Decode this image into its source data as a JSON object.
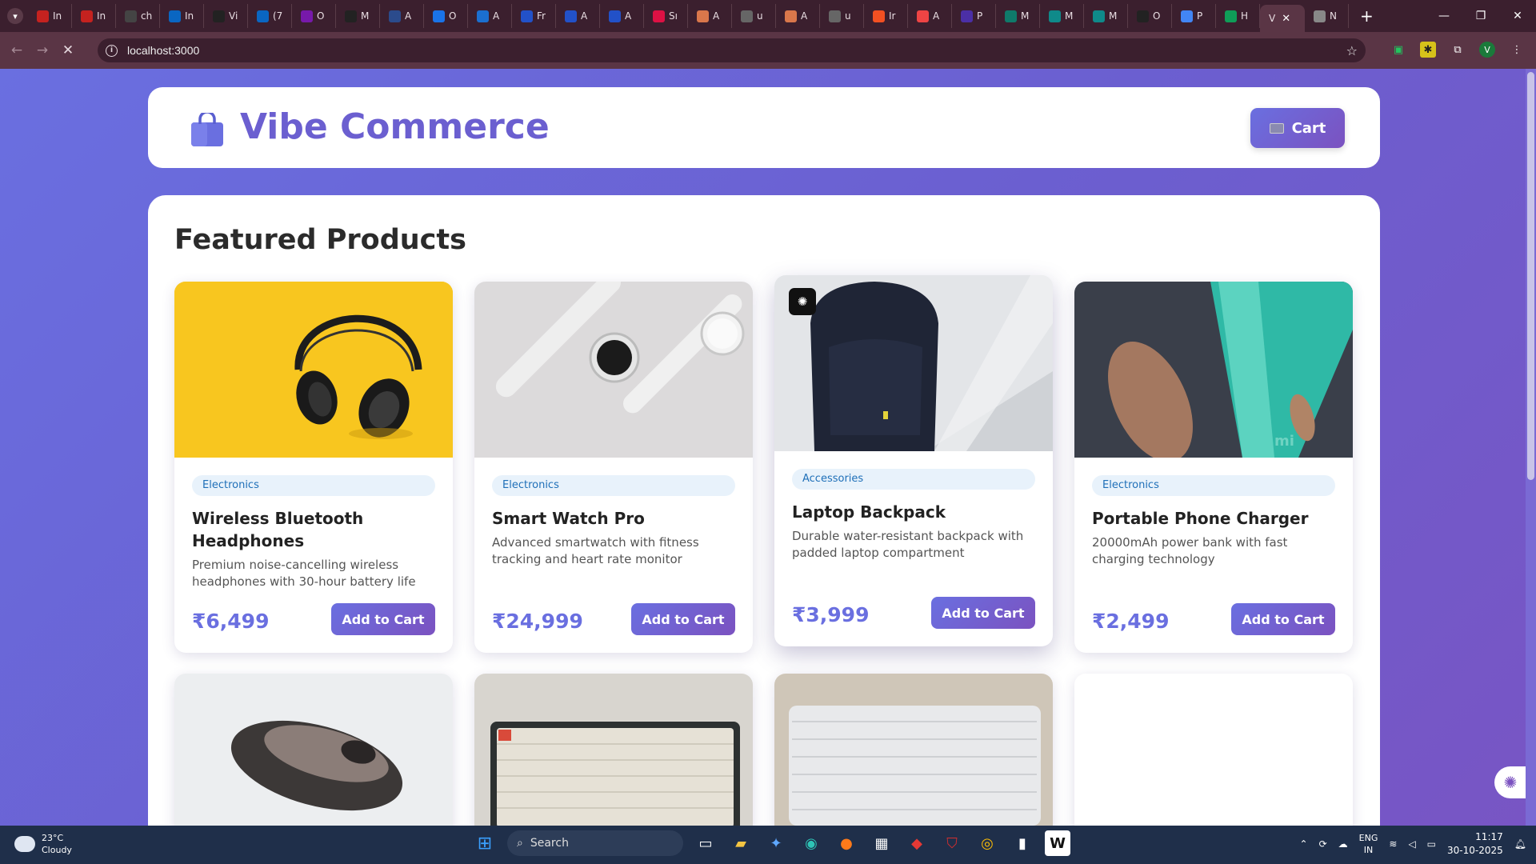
{
  "browser": {
    "tabs": [
      {
        "label": "In",
        "icon": "gmail-icon",
        "color": "#c5221f"
      },
      {
        "label": "In",
        "icon": "gmail-icon",
        "color": "#c5221f"
      },
      {
        "label": "ch",
        "icon": "openai-icon",
        "color": "#444"
      },
      {
        "label": "In",
        "icon": "linkedin-square-icon",
        "color": "#0a66c2"
      },
      {
        "label": "Vi",
        "icon": "github-icon",
        "color": "#222"
      },
      {
        "label": "(7",
        "icon": "linkedin-icon",
        "color": "#0a66c2"
      },
      {
        "label": "O",
        "icon": "onenote-icon",
        "color": "#7719aa"
      },
      {
        "label": "M",
        "icon": "medium-icon",
        "color": "#222"
      },
      {
        "label": "A",
        "icon": "crescent-icon",
        "color": "#2b4b8c"
      },
      {
        "label": "O",
        "icon": "target-icon",
        "color": "#1a73e8"
      },
      {
        "label": "A",
        "icon": "p-icon",
        "color": "#1b6fd0"
      },
      {
        "label": "Fr",
        "icon": "k-icon",
        "color": "#2251c8"
      },
      {
        "label": "A",
        "icon": "k-icon",
        "color": "#2251c8"
      },
      {
        "label": "A",
        "icon": "k-icon",
        "color": "#2251c8"
      },
      {
        "label": "Sı",
        "icon": "cube-icon",
        "color": "#d14"
      },
      {
        "label": "A",
        "icon": "anthropic-icon",
        "color": "#d9774b"
      },
      {
        "label": "u",
        "icon": "anthropic-icon",
        "color": "#666"
      },
      {
        "label": "A",
        "icon": "anthropic-icon",
        "color": "#d9774b"
      },
      {
        "label": "u",
        "icon": "anthropic-icon",
        "color": "#666"
      },
      {
        "label": "Ir",
        "icon": "microsoft-icon",
        "color": "#f25022"
      },
      {
        "label": "A",
        "icon": "chrome-web-icon",
        "color": "#e44"
      },
      {
        "label": "P",
        "icon": "pr-icon",
        "color": "#4b2fa6"
      },
      {
        "label": "M",
        "icon": "m365-icon",
        "color": "#0f7a6a"
      },
      {
        "label": "M",
        "icon": "nova-icon",
        "color": "#0f8a8a"
      },
      {
        "label": "M",
        "icon": "nova-icon",
        "color": "#0f8a8a"
      },
      {
        "label": "O",
        "icon": "notion-icon",
        "color": "#222"
      },
      {
        "label": "P",
        "icon": "docs-icon",
        "color": "#4285f4"
      },
      {
        "label": "H",
        "icon": "drive-icon",
        "color": "#0f9d58"
      },
      {
        "label": "V",
        "icon": "",
        "color": "#5a3545"
      },
      {
        "label": "N",
        "icon": "globe-icon",
        "color": "#888"
      }
    ],
    "url": "localhost:3000"
  },
  "header": {
    "brand": "Vibe Commerce",
    "cart_label": "Cart"
  },
  "main": {
    "title": "Featured Products",
    "products": [
      {
        "category": "Electronics",
        "name": "Wireless Bluetooth Headphones",
        "description": "Premium noise-cancelling wireless headphones with 30-hour battery life",
        "price": "₹6,499",
        "button": "Add to Cart"
      },
      {
        "category": "Electronics",
        "name": "Smart Watch Pro",
        "description": "Advanced smartwatch with fitness tracking and heart rate monitor",
        "price": "₹24,999",
        "button": "Add to Cart"
      },
      {
        "category": "Accessories",
        "name": "Laptop Backpack",
        "description": "Durable water-resistant backpack with padded laptop compartment",
        "price": "₹3,999",
        "button": "Add to Cart"
      },
      {
        "category": "Electronics",
        "name": "Portable Phone Charger",
        "description": "20000mAh power bank with fast charging technology",
        "price": "₹2,499",
        "button": "Add to Cart"
      }
    ]
  },
  "taskbar": {
    "weather_temp": "23°C",
    "weather_desc": "Cloudy",
    "search_placeholder": "Search",
    "lang_1": "ENG",
    "lang_2": "IN",
    "time": "11:17",
    "date": "30-10-2025"
  },
  "colors": {
    "accent": "#6a6fe0",
    "accent_2": "#7b52c0",
    "badge_bg": "#e8f2fb",
    "badge_text": "#1e6fb8"
  }
}
